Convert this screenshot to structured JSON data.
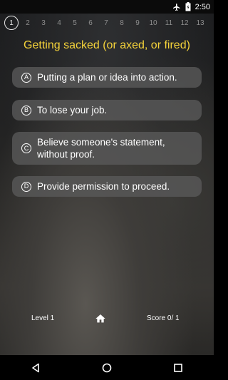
{
  "status_bar": {
    "time": "2:50"
  },
  "progress": {
    "current": "1",
    "others": [
      "2",
      "3",
      "4",
      "5",
      "6",
      "7",
      "8",
      "9",
      "10",
      "11",
      "12",
      "13"
    ]
  },
  "question": {
    "title": "Getting sacked (or axed, or fired)"
  },
  "answers": [
    {
      "letter": "A",
      "text": "Putting a plan or idea into action."
    },
    {
      "letter": "B",
      "text": "To lose your job."
    },
    {
      "letter": "C",
      "text": "Believe someone's statement, without proof."
    },
    {
      "letter": "D",
      "text": "Provide permission to proceed."
    }
  ],
  "footer": {
    "level": "Level 1",
    "score": "Score 0/  1"
  },
  "icons": {
    "airplane": "airplane-mode-icon",
    "battery": "battery-icon",
    "home": "home-icon",
    "back": "nav-back-icon",
    "home_nav": "nav-home-icon",
    "recents": "nav-recents-icon"
  }
}
